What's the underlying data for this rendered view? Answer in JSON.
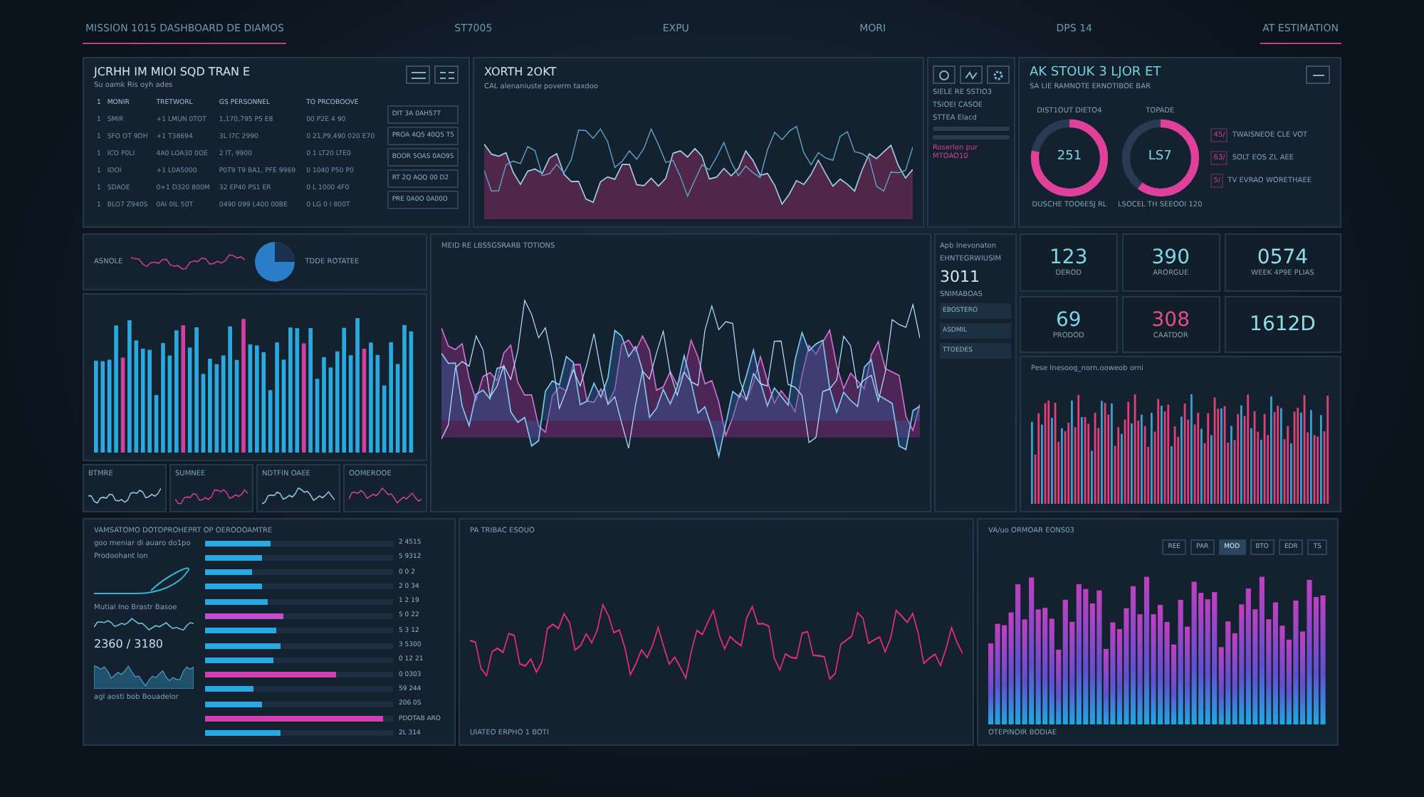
{
  "nav": [
    {
      "label": "MISSION 1015 DASHBOARD DE DIAMOS",
      "selected": true
    },
    {
      "label": "ST7005",
      "selected": false
    },
    {
      "label": "EXPU",
      "selected": false
    },
    {
      "label": "MORI",
      "selected": false
    },
    {
      "label": "DPS 14",
      "selected": false
    },
    {
      "label": "AT ESTIMATION",
      "selected": true
    }
  ],
  "table_panel": {
    "title": "JCRHH IM MIOI SQD TRAN E",
    "subtitle": "Su oamk Ris oyh ades",
    "columns": [
      "1",
      "MONIR",
      "TRETWORL",
      "GS PERSONNEL",
      "TO PRCOBOOVE"
    ],
    "rows": [
      [
        "1",
        "SMIR",
        "+1 LMUN 0TOT",
        "1,170,795 P5 E8",
        "00 P2E 4 90"
      ],
      [
        "1",
        "SFO OT 9DH",
        "+1 T38694",
        "3L I7C 2990",
        "0 21,P9,490 020 E70"
      ],
      [
        "1",
        "ICO P0LI",
        "4A0 LOA30 0OE",
        "2 IT, 9900",
        "0 1 LT20 LTE0"
      ],
      [
        "1",
        "IDOI",
        "+1 L0A5000",
        "P0T9 T9 BA1, PFE 9969",
        "0 1040 P50 P0"
      ],
      [
        "1",
        "SDAOE",
        "0+1 D320 800M",
        "32 EP40 PS1 ER",
        "0 L 1000 4F0"
      ],
      [
        "1",
        "BLO7 Z940S",
        "0AI 0IL 50T",
        "0490 099 L400 00BE",
        "0 LG 0 I 800T"
      ]
    ],
    "side_list": [
      "DIT 3A 0AH57T",
      "PROA 4Q5 40Q5 T5",
      "BOOR 5OAS 0AO95",
      "RT 2Q AQQ 00 D2",
      "PRE 0A0O 0A00O"
    ]
  },
  "trend_panel": {
    "title": "XORTH 2OKT",
    "subtitle": "CAL alenaniuste poverm taxdoo"
  },
  "tools_panel": {
    "lines": [
      "SIELE RE SSTIO3",
      "TSIOEI CASOE",
      "STTEA Elacd"
    ],
    "footer": "Roserlon pur MTOAO10"
  },
  "donut_panel": {
    "title": "AK STOUK 3 LJOR ET",
    "subtitle": "SA LIE RAMNOTE ERNOTIBOE BAR",
    "donuts": [
      {
        "label": "DIST1OUT DIETO4",
        "center": "251",
        "caption": "DUSCHE TOO6ESJ RL",
        "level": 0.78
      },
      {
        "label": "TOPADE",
        "center": "LS7",
        "caption": "LSOCEL TH SEEOOI 120",
        "level": 0.6
      }
    ],
    "legend": [
      {
        "tag": "45/",
        "text": "TWAISNEOE CLE VOT"
      },
      {
        "tag": "63/",
        "text": "SOLT EOS ZL AEE"
      },
      {
        "tag": "5/",
        "text": "TV EVRAO WORETHAEE"
      }
    ]
  },
  "left_strip": {
    "title": "ASNOLE",
    "label": "TDDE ROTATEE"
  },
  "wave_panel": {
    "title": "MEID RE LBSSGSRARB TOTIONS"
  },
  "readout_panel": {
    "title": "Apb Inevonaton",
    "label": "EHNTEGRWIUSIM",
    "value": "3011",
    "note": "SNIMABOAS",
    "items": [
      "EBOSTERO",
      "ASDMIL",
      "TTOEDES"
    ]
  },
  "metrics": [
    {
      "value": "123",
      "caption": "DEROD",
      "color": "#7fd6e6"
    },
    {
      "value": "390",
      "caption": "ARORGUE",
      "color": "#7fd6e6"
    },
    {
      "value": "0574",
      "caption": "WEEK 4P9E PLIAS",
      "color": "#8fdcea"
    },
    {
      "value": "69",
      "caption": "PRODOD",
      "color": "#7fd6e6"
    },
    {
      "value": "308",
      "caption": "CAATDOR",
      "color": "#e0508f"
    },
    {
      "value": "1612D",
      "color": "#8fdcea"
    }
  ],
  "spectrum_panel": {
    "title": "Pese Inesoog_norn.ooweob orni"
  },
  "mini_panels": [
    {
      "title": "BTMRE"
    },
    {
      "title": "SUMNEE"
    },
    {
      "title": "NDTFIN OAEE"
    },
    {
      "title": "OOMEROOE"
    }
  ],
  "bars_panel": {
    "title": "VAMSATOMO DOTOPROHEPRT OP OEROOOAMTRE",
    "note": "goo meniar di auaro do1po",
    "curve_label": "Prodoohant lon",
    "wave_label": "Mutial Ino Brastr Basoe",
    "reading": "2360 / 3180",
    "footer": "agl aosti bob Bouadelor",
    "rows": [
      {
        "value": "2 4515",
        "level": 0.35,
        "color": "#2aa9e0"
      },
      {
        "value": "5 9312",
        "level": 0.3,
        "color": "#2aa9e0"
      },
      {
        "value": "0 0 2",
        "level": 0.25,
        "color": "#2aa9e0"
      },
      {
        "value": "2 0 34",
        "level": 0.3,
        "color": "#2aa9e0"
      },
      {
        "value": "1 2 19",
        "level": 0.33,
        "color": "#2aa9e0"
      },
      {
        "value": "5 0 22",
        "level": 0.42,
        "color": "#c050d0"
      },
      {
        "value": "5 3 12",
        "level": 0.38,
        "color": "#2aa9e0"
      },
      {
        "value": "3 5300",
        "level": 0.4,
        "color": "#2aa9e0"
      },
      {
        "value": "0 12 21",
        "level": 0.36,
        "color": "#2aa9e0"
      },
      {
        "value": "0 0303",
        "level": 0.7,
        "color": "#d040b0"
      },
      {
        "value": "59 244",
        "level": 0.26,
        "color": "#2aa9e0"
      },
      {
        "value": "206 0S",
        "level": 0.3,
        "color": "#2aa9e0"
      },
      {
        "value": "PDOTAB ARO",
        "level": 0.95,
        "color": "#d040b0"
      },
      {
        "value": "2L 314",
        "level": 0.4,
        "color": "#2aa9e0"
      }
    ]
  },
  "signal_panel": {
    "title": "PA TRIBAC ESOUO",
    "footer": "UIATEO ERPHO 1 BOTI"
  },
  "column_panel": {
    "title": "VA/uo ORMOAR EONS03",
    "tabs": [
      {
        "label": "REE",
        "selected": false
      },
      {
        "label": "PAR",
        "selected": false
      },
      {
        "label": "MOD",
        "selected": true
      },
      {
        "label": "BTO",
        "selected": false
      },
      {
        "label": "EDR",
        "selected": false
      },
      {
        "label": "TS",
        "selected": false
      }
    ],
    "footer": "OTEPINOIR BODIAE"
  }
}
